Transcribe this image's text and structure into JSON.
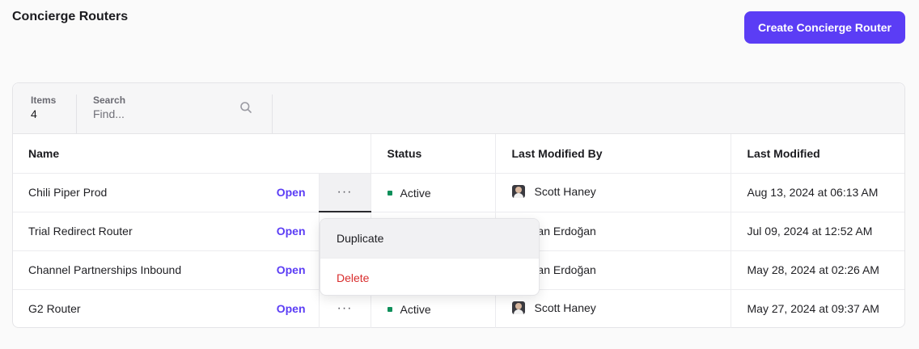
{
  "header": {
    "title": "Concierge Routers",
    "create_label": "Create Concierge Router"
  },
  "toolbar": {
    "items_label": "Items",
    "items_count": "4",
    "search_label": "Search",
    "search_placeholder": "Find..."
  },
  "table": {
    "columns": {
      "name": "Name",
      "status": "Status",
      "last_modified_by": "Last Modified By",
      "last_modified": "Last Modified"
    },
    "open_label": "Open",
    "more_label": "···",
    "rows": [
      {
        "name": "Chili Piper Prod",
        "status": "Active",
        "modified_by": "Scott Haney",
        "modified": "Aug 13, 2024 at 06:13 AM"
      },
      {
        "name": "Trial Redirect Router",
        "status": "",
        "modified_by": "Batıkan Erdoğan",
        "modified": "Jul 09, 2024 at 12:52 AM"
      },
      {
        "name": "Channel Partnerships Inbound",
        "status": "",
        "modified_by": "Batıkan Erdoğan",
        "modified": "May 28, 2024 at 02:26 AM"
      },
      {
        "name": "G2 Router",
        "status": "Active",
        "modified_by": "Scott Haney",
        "modified": "May 27, 2024 at 09:37 AM"
      }
    ]
  },
  "menu": {
    "duplicate_label": "Duplicate",
    "delete_label": "Delete"
  },
  "icons": {
    "search": "search-icon",
    "status": "status-dot-icon",
    "avatar": "user-avatar"
  },
  "colors": {
    "accent": "#5b3df5",
    "status_active": "#0e8f5a",
    "danger": "#d92d2d"
  }
}
